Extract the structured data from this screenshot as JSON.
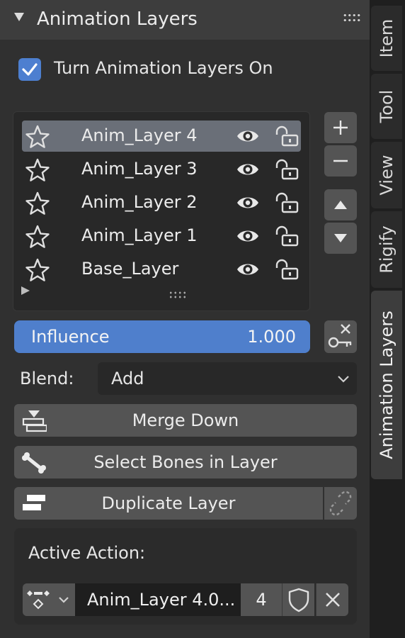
{
  "panel": {
    "title": "Animation Layers",
    "collapse_icon": "disclosure-triangle-down-icon",
    "drag_icon": "drag-handle-icon"
  },
  "toggle": {
    "label": "Turn Animation Layers On",
    "checked": true
  },
  "layers": [
    {
      "name": "Anim_Layer 4",
      "selected": true
    },
    {
      "name": "Anim_Layer 3",
      "selected": false
    },
    {
      "name": "Anim_Layer 2",
      "selected": false
    },
    {
      "name": "Anim_Layer 1",
      "selected": false
    },
    {
      "name": "Base_Layer",
      "selected": false
    }
  ],
  "list_side_buttons": {
    "add": "plus-icon",
    "remove": "minus-icon",
    "move_up": "triangle-up-icon",
    "move_down": "triangle-down-icon"
  },
  "influence": {
    "label": "Influence",
    "value": "1.000"
  },
  "blend": {
    "label": "Blend:",
    "value": "Add"
  },
  "buttons": {
    "merge_down": "Merge Down",
    "select_bones": "Select Bones in Layer",
    "duplicate": "Duplicate Layer"
  },
  "active_action": {
    "label": "Active Action:",
    "name": "Anim_Layer 4.0...",
    "users": "4"
  },
  "tabs": [
    {
      "label": "Item",
      "active": false
    },
    {
      "label": "Tool",
      "active": false
    },
    {
      "label": "View",
      "active": false
    },
    {
      "label": "Rigify",
      "active": false
    },
    {
      "label": "Animation Layers",
      "active": true
    }
  ],
  "colors": {
    "accent": "#4f7fcc",
    "checkbox": "#4d7fd0",
    "panel_bg": "#303030",
    "header_bg": "#3d3d3d",
    "button_bg": "#545454",
    "selected_row": "#6a6f78"
  }
}
